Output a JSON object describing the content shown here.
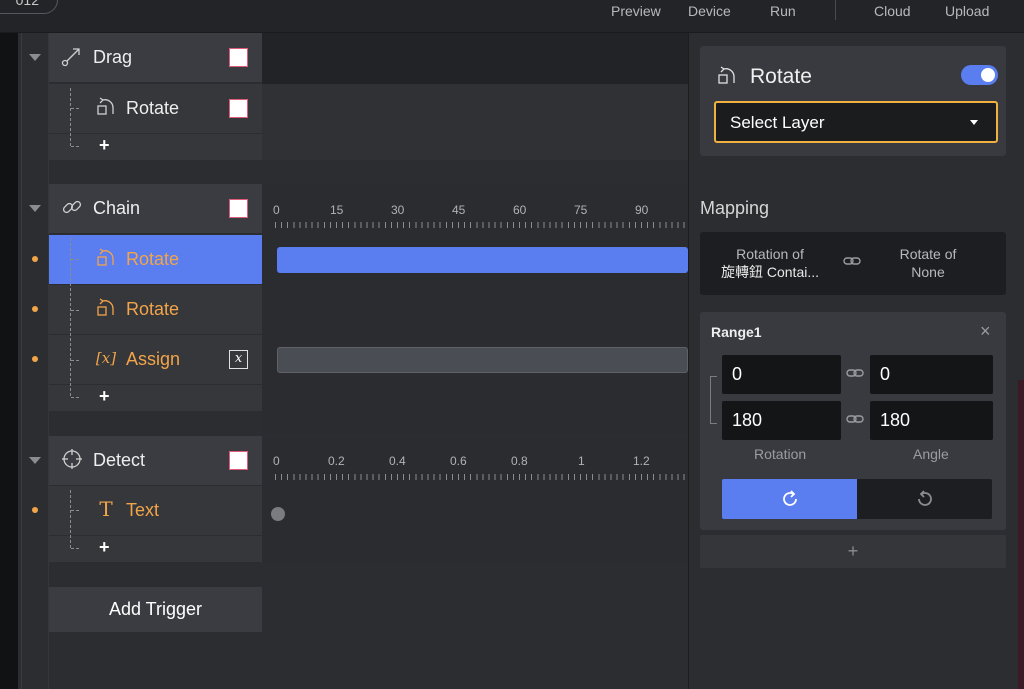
{
  "topbar": {
    "project_label": "012",
    "preview": "Preview",
    "device": "Device",
    "run": "Run",
    "cloud": "Cloud",
    "upload": "Upload"
  },
  "tree": {
    "drag": {
      "label": "Drag",
      "icon": "drag-icon"
    },
    "drag_rotate": {
      "label": "Rotate",
      "icon": "rotate-icon"
    },
    "chain": {
      "label": "Chain",
      "icon": "chain-link-icon"
    },
    "chain_rotate_1": {
      "label": "Rotate",
      "icon": "rotate-icon"
    },
    "chain_rotate_2": {
      "label": "Rotate",
      "icon": "rotate-icon"
    },
    "chain_assign": {
      "label": "Assign",
      "icon": "variable-x-icon",
      "box_glyph": "x"
    },
    "detect": {
      "label": "Detect",
      "icon": "crosshair-icon"
    },
    "detect_text": {
      "label": "Text",
      "icon": "text-t-icon"
    },
    "add_symbol": "+",
    "add_trigger": "Add Trigger"
  },
  "timeline": {
    "chain_ticks": [
      "0",
      "15",
      "30",
      "45",
      "60",
      "75",
      "90"
    ],
    "detect_ticks": [
      "0",
      "0.2",
      "0.4",
      "0.6",
      "0.8",
      "1",
      "1.2"
    ]
  },
  "inspector": {
    "title": "Rotate",
    "title_icon": "rotate-icon",
    "enabled": true,
    "select_layer": "Select Layer",
    "mapping_heading": "Mapping",
    "mapping_from_line1": "Rotation of",
    "mapping_from_line2": "旋轉鈕 Contai...",
    "mapping_to_line1": "Rotate of",
    "mapping_to_line2": "None",
    "range_title": "Range1",
    "range_from_min": "0",
    "range_to_min": "0",
    "range_from_max": "180",
    "range_to_max": "180",
    "col_rotation": "Rotation",
    "col_angle": "Angle",
    "clockwise_selected": true,
    "add_range": "+"
  },
  "colors": {
    "accent_blue": "#5a7df0",
    "orange": "#f2a449",
    "select_border": "#f0b042"
  }
}
